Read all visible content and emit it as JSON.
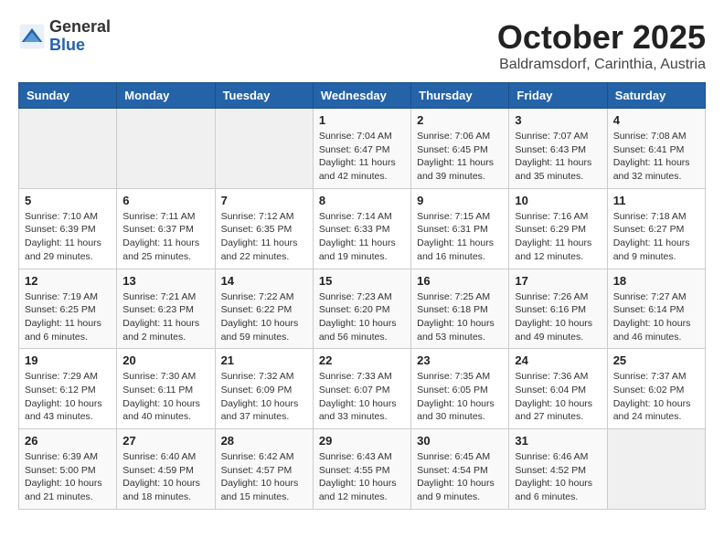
{
  "header": {
    "logo_general": "General",
    "logo_blue": "Blue",
    "month_title": "October 2025",
    "subtitle": "Baldramsdorf, Carinthia, Austria"
  },
  "days_of_week": [
    "Sunday",
    "Monday",
    "Tuesday",
    "Wednesday",
    "Thursday",
    "Friday",
    "Saturday"
  ],
  "weeks": [
    [
      {
        "day": "",
        "detail": ""
      },
      {
        "day": "",
        "detail": ""
      },
      {
        "day": "",
        "detail": ""
      },
      {
        "day": "1",
        "detail": "Sunrise: 7:04 AM\nSunset: 6:47 PM\nDaylight: 11 hours\nand 42 minutes."
      },
      {
        "day": "2",
        "detail": "Sunrise: 7:06 AM\nSunset: 6:45 PM\nDaylight: 11 hours\nand 39 minutes."
      },
      {
        "day": "3",
        "detail": "Sunrise: 7:07 AM\nSunset: 6:43 PM\nDaylight: 11 hours\nand 35 minutes."
      },
      {
        "day": "4",
        "detail": "Sunrise: 7:08 AM\nSunset: 6:41 PM\nDaylight: 11 hours\nand 32 minutes."
      }
    ],
    [
      {
        "day": "5",
        "detail": "Sunrise: 7:10 AM\nSunset: 6:39 PM\nDaylight: 11 hours\nand 29 minutes."
      },
      {
        "day": "6",
        "detail": "Sunrise: 7:11 AM\nSunset: 6:37 PM\nDaylight: 11 hours\nand 25 minutes."
      },
      {
        "day": "7",
        "detail": "Sunrise: 7:12 AM\nSunset: 6:35 PM\nDaylight: 11 hours\nand 22 minutes."
      },
      {
        "day": "8",
        "detail": "Sunrise: 7:14 AM\nSunset: 6:33 PM\nDaylight: 11 hours\nand 19 minutes."
      },
      {
        "day": "9",
        "detail": "Sunrise: 7:15 AM\nSunset: 6:31 PM\nDaylight: 11 hours\nand 16 minutes."
      },
      {
        "day": "10",
        "detail": "Sunrise: 7:16 AM\nSunset: 6:29 PM\nDaylight: 11 hours\nand 12 minutes."
      },
      {
        "day": "11",
        "detail": "Sunrise: 7:18 AM\nSunset: 6:27 PM\nDaylight: 11 hours\nand 9 minutes."
      }
    ],
    [
      {
        "day": "12",
        "detail": "Sunrise: 7:19 AM\nSunset: 6:25 PM\nDaylight: 11 hours\nand 6 minutes."
      },
      {
        "day": "13",
        "detail": "Sunrise: 7:21 AM\nSunset: 6:23 PM\nDaylight: 11 hours\nand 2 minutes."
      },
      {
        "day": "14",
        "detail": "Sunrise: 7:22 AM\nSunset: 6:22 PM\nDaylight: 10 hours\nand 59 minutes."
      },
      {
        "day": "15",
        "detail": "Sunrise: 7:23 AM\nSunset: 6:20 PM\nDaylight: 10 hours\nand 56 minutes."
      },
      {
        "day": "16",
        "detail": "Sunrise: 7:25 AM\nSunset: 6:18 PM\nDaylight: 10 hours\nand 53 minutes."
      },
      {
        "day": "17",
        "detail": "Sunrise: 7:26 AM\nSunset: 6:16 PM\nDaylight: 10 hours\nand 49 minutes."
      },
      {
        "day": "18",
        "detail": "Sunrise: 7:27 AM\nSunset: 6:14 PM\nDaylight: 10 hours\nand 46 minutes."
      }
    ],
    [
      {
        "day": "19",
        "detail": "Sunrise: 7:29 AM\nSunset: 6:12 PM\nDaylight: 10 hours\nand 43 minutes."
      },
      {
        "day": "20",
        "detail": "Sunrise: 7:30 AM\nSunset: 6:11 PM\nDaylight: 10 hours\nand 40 minutes."
      },
      {
        "day": "21",
        "detail": "Sunrise: 7:32 AM\nSunset: 6:09 PM\nDaylight: 10 hours\nand 37 minutes."
      },
      {
        "day": "22",
        "detail": "Sunrise: 7:33 AM\nSunset: 6:07 PM\nDaylight: 10 hours\nand 33 minutes."
      },
      {
        "day": "23",
        "detail": "Sunrise: 7:35 AM\nSunset: 6:05 PM\nDaylight: 10 hours\nand 30 minutes."
      },
      {
        "day": "24",
        "detail": "Sunrise: 7:36 AM\nSunset: 6:04 PM\nDaylight: 10 hours\nand 27 minutes."
      },
      {
        "day": "25",
        "detail": "Sunrise: 7:37 AM\nSunset: 6:02 PM\nDaylight: 10 hours\nand 24 minutes."
      }
    ],
    [
      {
        "day": "26",
        "detail": "Sunrise: 6:39 AM\nSunset: 5:00 PM\nDaylight: 10 hours\nand 21 minutes."
      },
      {
        "day": "27",
        "detail": "Sunrise: 6:40 AM\nSunset: 4:59 PM\nDaylight: 10 hours\nand 18 minutes."
      },
      {
        "day": "28",
        "detail": "Sunrise: 6:42 AM\nSunset: 4:57 PM\nDaylight: 10 hours\nand 15 minutes."
      },
      {
        "day": "29",
        "detail": "Sunrise: 6:43 AM\nSunset: 4:55 PM\nDaylight: 10 hours\nand 12 minutes."
      },
      {
        "day": "30",
        "detail": "Sunrise: 6:45 AM\nSunset: 4:54 PM\nDaylight: 10 hours\nand 9 minutes."
      },
      {
        "day": "31",
        "detail": "Sunrise: 6:46 AM\nSunset: 4:52 PM\nDaylight: 10 hours\nand 6 minutes."
      },
      {
        "day": "",
        "detail": ""
      }
    ]
  ]
}
